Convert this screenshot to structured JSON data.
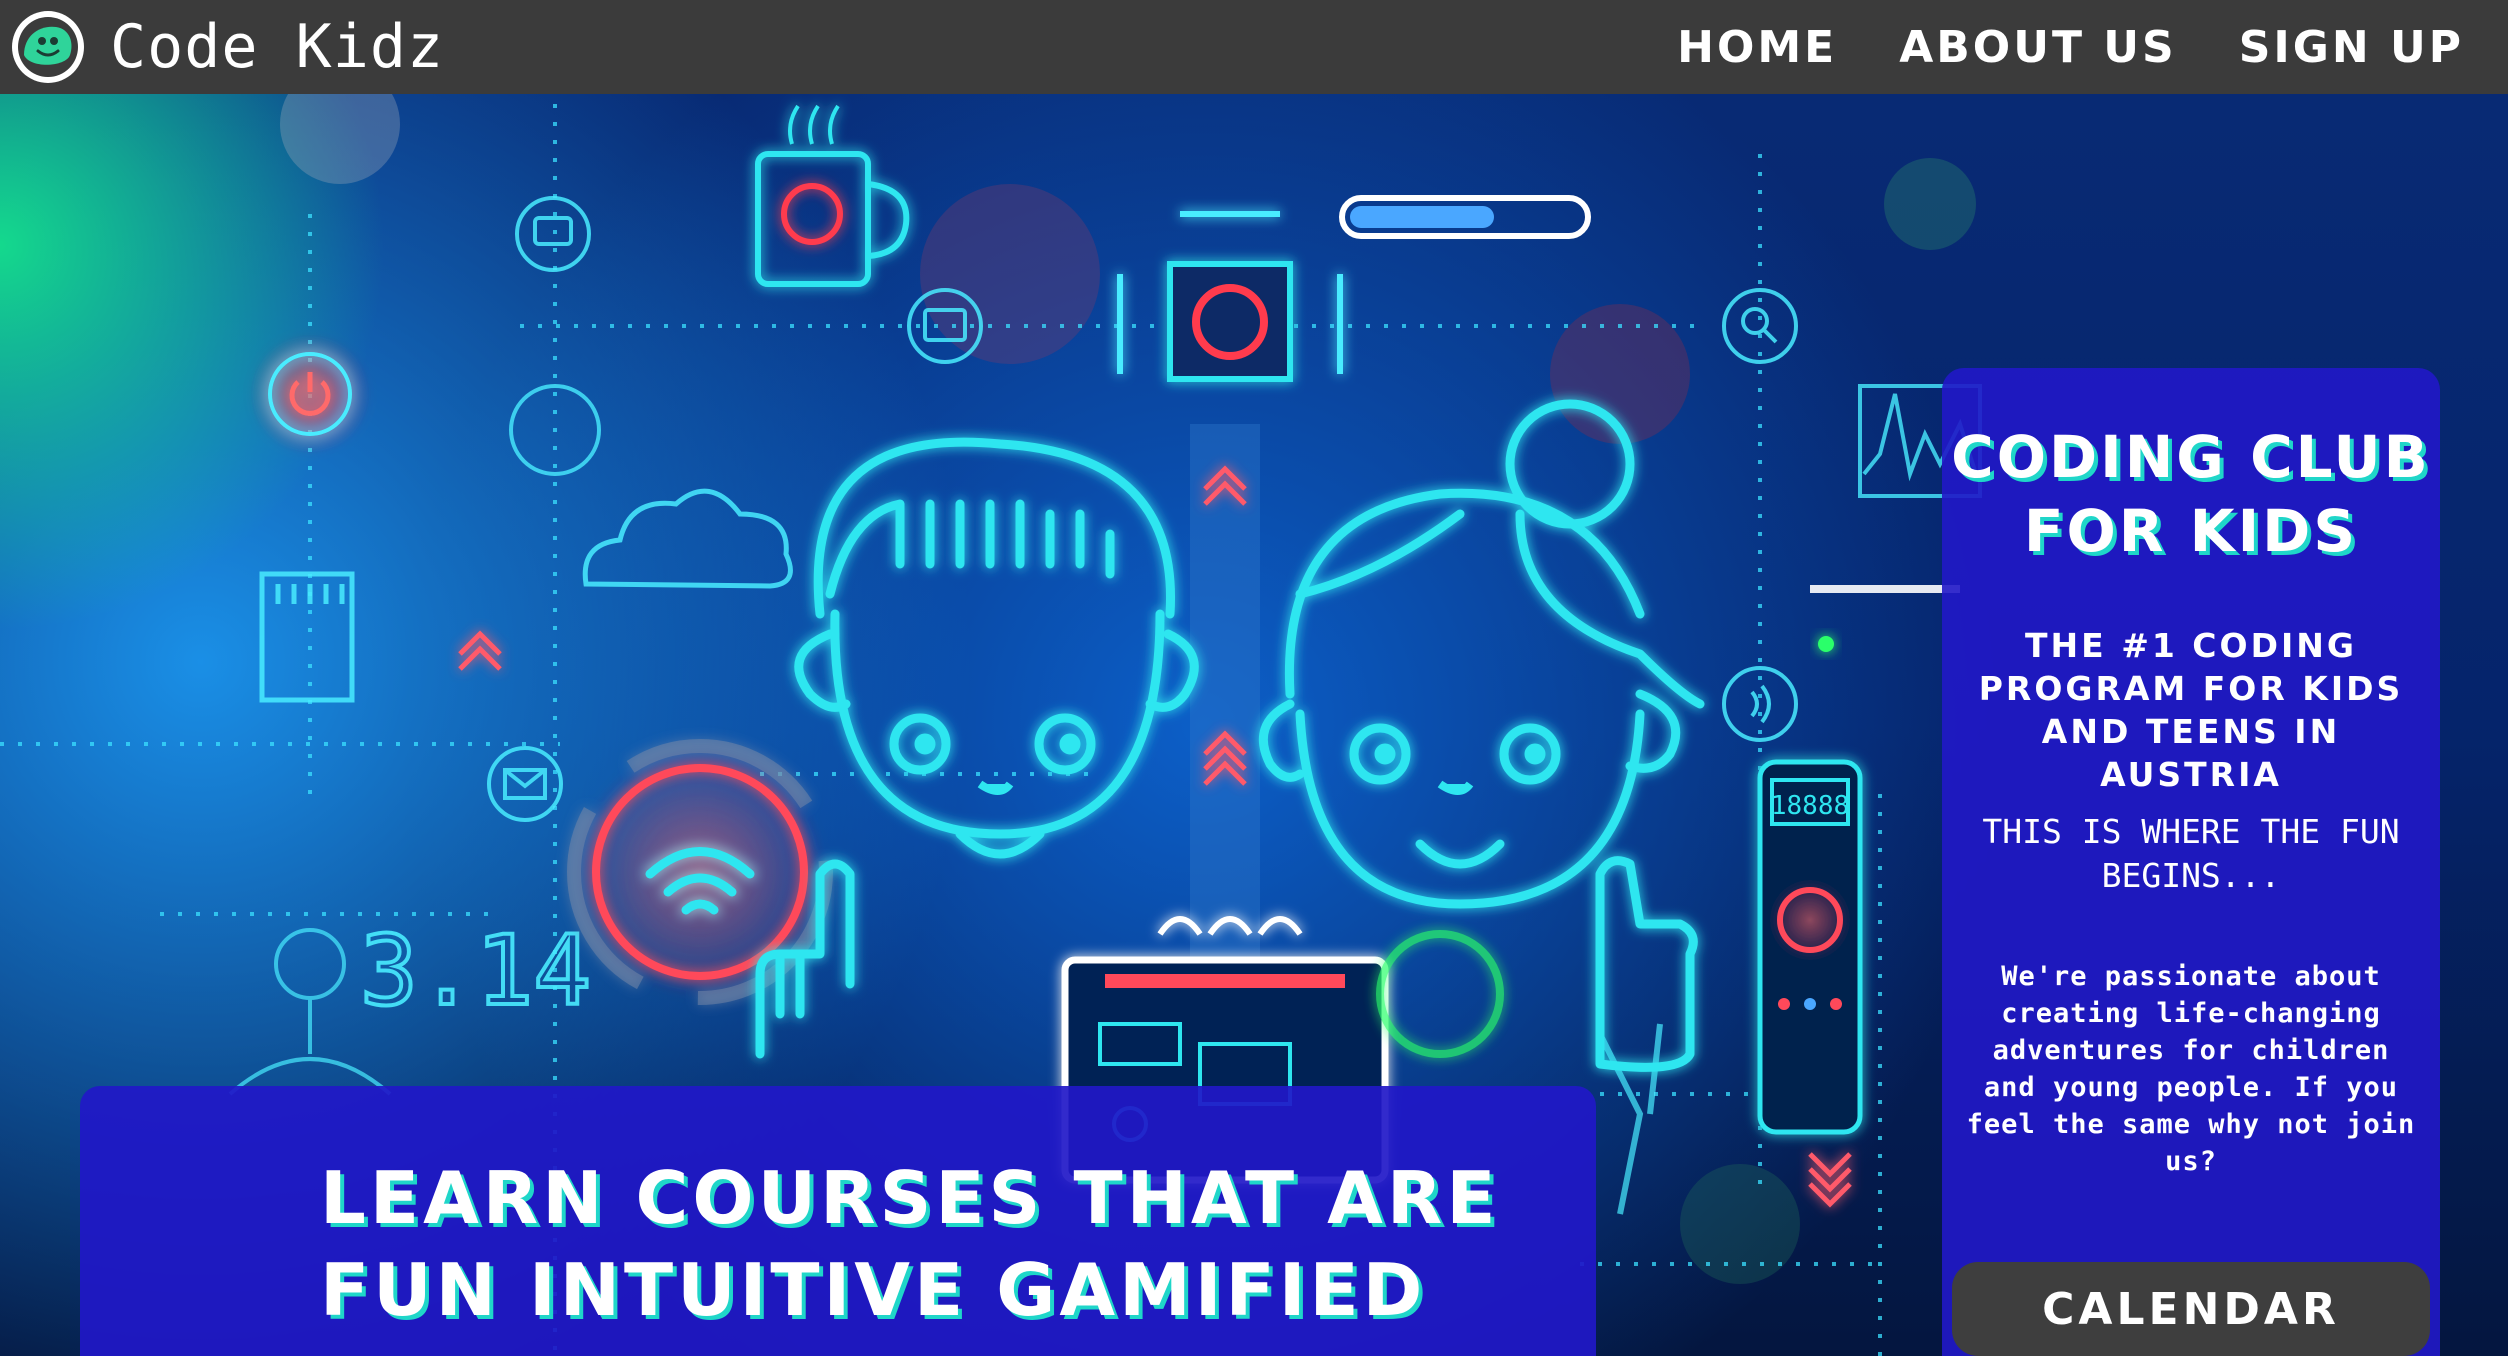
{
  "brand": {
    "name": "Code Kidz",
    "icon": "smiling-blob-icon"
  },
  "nav": {
    "home": "HOME",
    "about": "ABOUT US",
    "signup": "SIGN UP"
  },
  "hero": {
    "image": "neon-circuit-kids-illustration",
    "glowing_digits": "3.14",
    "meter_readout": "18888"
  },
  "banner": {
    "line1": "LEARN COURSES THAT ARE",
    "line2": "FUN INTUITIVE GAMIFIED"
  },
  "panel": {
    "title_line1": "CODING CLUB",
    "title_line2": "FOR KIDS",
    "subtitle": "THE #1 CODING PROGRAM FOR KIDS AND TEENS IN AUSTRIA",
    "tagline": "THIS IS WHERE THE FUN BEGINS...",
    "description": "We're passionate about creating life-changing adventures for children and young people. If you feel the same why not join us?",
    "button": "CALENDAR"
  },
  "colors": {
    "navbar": "#3b3b3b",
    "panel_blue": "#2118c8",
    "text_shadow_cyan": "#1fd6c9",
    "button_dark": "#3e3e3e",
    "neon_cyan": "#27e6f0",
    "neon_red": "#ff3b4d"
  }
}
